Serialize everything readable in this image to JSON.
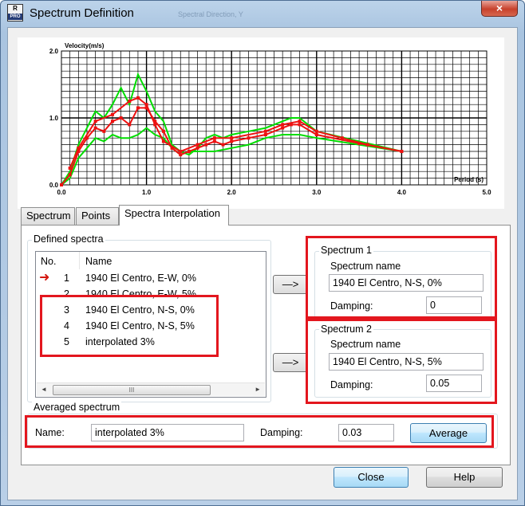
{
  "window": {
    "title": "Spectrum Definition",
    "ghost_title": "Spectral Direction, Y",
    "close_glyph": "×",
    "app_icon": {
      "top": "R",
      "bottom": "PRO"
    }
  },
  "chart_data": {
    "type": "line",
    "ylabel": "Velocity(m/s)",
    "xlabel": "Period (s)",
    "xlim": [
      0.0,
      5.0
    ],
    "ylim": [
      0.0,
      2.0
    ],
    "x_ticks": [
      "0.0",
      "1.0",
      "2.0",
      "3.0",
      "4.0",
      "5.0"
    ],
    "y_ticks": [
      "0.0",
      "1.0",
      "2.0"
    ],
    "grid": true,
    "series": [
      {
        "color": "#00dd00",
        "points": [
          [
            0.0,
            0.0
          ],
          [
            0.1,
            0.2
          ],
          [
            0.2,
            0.6
          ],
          [
            0.3,
            0.85
          ],
          [
            0.4,
            1.1
          ],
          [
            0.5,
            1.0
          ],
          [
            0.6,
            1.2
          ],
          [
            0.7,
            1.45
          ],
          [
            0.8,
            1.2
          ],
          [
            0.9,
            1.65
          ],
          [
            1.0,
            1.4
          ],
          [
            1.1,
            1.1
          ],
          [
            1.2,
            0.95
          ],
          [
            1.3,
            0.6
          ],
          [
            1.4,
            0.5
          ],
          [
            1.5,
            0.45
          ],
          [
            1.6,
            0.55
          ],
          [
            1.7,
            0.7
          ],
          [
            1.8,
            0.75
          ],
          [
            1.9,
            0.7
          ],
          [
            2.0,
            0.75
          ],
          [
            2.2,
            0.8
          ],
          [
            2.4,
            0.85
          ],
          [
            2.6,
            0.95
          ],
          [
            2.7,
            1.0
          ],
          [
            2.8,
            1.0
          ],
          [
            3.0,
            0.8
          ],
          [
            3.5,
            0.65
          ],
          [
            4.0,
            0.5
          ]
        ]
      },
      {
        "color": "#00dd00",
        "points": [
          [
            0.0,
            0.0
          ],
          [
            0.1,
            0.1
          ],
          [
            0.2,
            0.4
          ],
          [
            0.3,
            0.55
          ],
          [
            0.4,
            0.7
          ],
          [
            0.5,
            0.65
          ],
          [
            0.6,
            0.75
          ],
          [
            0.7,
            0.7
          ],
          [
            0.8,
            0.7
          ],
          [
            0.9,
            0.75
          ],
          [
            1.0,
            0.85
          ],
          [
            1.1,
            0.75
          ],
          [
            1.2,
            0.7
          ],
          [
            1.3,
            0.55
          ],
          [
            1.4,
            0.45
          ],
          [
            1.5,
            0.5
          ],
          [
            1.6,
            0.5
          ],
          [
            1.8,
            0.5
          ],
          [
            2.0,
            0.55
          ],
          [
            2.2,
            0.6
          ],
          [
            2.4,
            0.7
          ],
          [
            2.6,
            0.75
          ],
          [
            2.8,
            0.75
          ],
          [
            3.0,
            0.7
          ],
          [
            3.5,
            0.6
          ],
          [
            4.0,
            0.5
          ]
        ]
      },
      {
        "color": "#ee1111",
        "markers": true,
        "points": [
          [
            0.0,
            0.0
          ],
          [
            0.1,
            0.15
          ],
          [
            0.2,
            0.5
          ],
          [
            0.3,
            0.7
          ],
          [
            0.4,
            0.85
          ],
          [
            0.5,
            0.8
          ],
          [
            0.6,
            0.95
          ],
          [
            0.7,
            1.0
          ],
          [
            0.8,
            0.9
          ],
          [
            0.9,
            1.15
          ],
          [
            1.0,
            1.15
          ],
          [
            1.1,
            0.95
          ],
          [
            1.2,
            0.8
          ],
          [
            1.3,
            0.55
          ],
          [
            1.4,
            0.45
          ],
          [
            1.5,
            0.5
          ],
          [
            1.6,
            0.55
          ],
          [
            1.7,
            0.6
          ],
          [
            1.8,
            0.65
          ],
          [
            1.9,
            0.6
          ],
          [
            2.0,
            0.65
          ],
          [
            2.2,
            0.7
          ],
          [
            2.4,
            0.75
          ],
          [
            2.6,
            0.85
          ],
          [
            2.7,
            0.9
          ],
          [
            2.8,
            0.9
          ],
          [
            3.0,
            0.75
          ],
          [
            3.5,
            0.62
          ],
          [
            4.0,
            0.5
          ]
        ]
      },
      {
        "color": "#ee1111",
        "markers": true,
        "points": [
          [
            0.1,
            0.25
          ],
          [
            0.2,
            0.55
          ],
          [
            0.4,
            0.95
          ],
          [
            0.6,
            1.05
          ],
          [
            0.8,
            1.25
          ],
          [
            0.9,
            1.3
          ],
          [
            1.0,
            1.2
          ],
          [
            1.1,
            0.9
          ],
          [
            1.2,
            0.65
          ],
          [
            1.4,
            0.5
          ],
          [
            1.6,
            0.6
          ],
          [
            1.8,
            0.7
          ],
          [
            2.0,
            0.7
          ],
          [
            2.4,
            0.8
          ],
          [
            2.6,
            0.9
          ],
          [
            2.8,
            0.95
          ],
          [
            3.0,
            0.8
          ],
          [
            3.3,
            0.7
          ],
          [
            3.6,
            0.6
          ],
          [
            4.0,
            0.5
          ]
        ]
      }
    ]
  },
  "tabs": [
    {
      "label": "Spectrum",
      "active": false
    },
    {
      "label": "Points",
      "active": false
    },
    {
      "label": "Spectra Interpolation",
      "active": true
    }
  ],
  "defined_spectra": {
    "label": "Defined spectra",
    "columns": [
      "No.",
      "Name"
    ],
    "rows": [
      {
        "no": "1",
        "name": "1940 El Centro, E-W, 0%",
        "current": true
      },
      {
        "no": "2",
        "name": "1940 El Centro, E-W, 5%",
        "current": false
      },
      {
        "no": "3",
        "name": "1940 El Centro, N-S, 0%",
        "current": false
      },
      {
        "no": "4",
        "name": "1940 El Centro, N-S, 5%",
        "current": false
      },
      {
        "no": "5",
        "name": "interpolated 3%",
        "current": false
      }
    ],
    "scroll_left": "◄",
    "scroll_right": "►",
    "scroll_thumb": "III"
  },
  "transfer_buttons": [
    "—>",
    "—>"
  ],
  "spectrum1": {
    "title": "Spectrum 1",
    "name_label": "Spectrum name",
    "name_value": "1940 El Centro, N-S, 0%",
    "damping_label": "Damping:",
    "damping_value": "0"
  },
  "spectrum2": {
    "title": "Spectrum 2",
    "name_label": "Spectrum name",
    "name_value": "1940 El Centro, N-S, 5%",
    "damping_label": "Damping:",
    "damping_value": "0.05"
  },
  "averaged": {
    "title": "Averaged spectrum",
    "name_label": "Name:",
    "name_value": "interpolated 3%",
    "damping_label": "Damping:",
    "damping_value": "0.03",
    "average_button": "Average"
  },
  "footer": {
    "close_button": "Close",
    "help_button": "Help"
  },
  "colors": {
    "highlight": "#e3161e",
    "arrow": "#d3170f",
    "green_series": "#00dd00",
    "red_series": "#ee1111"
  }
}
